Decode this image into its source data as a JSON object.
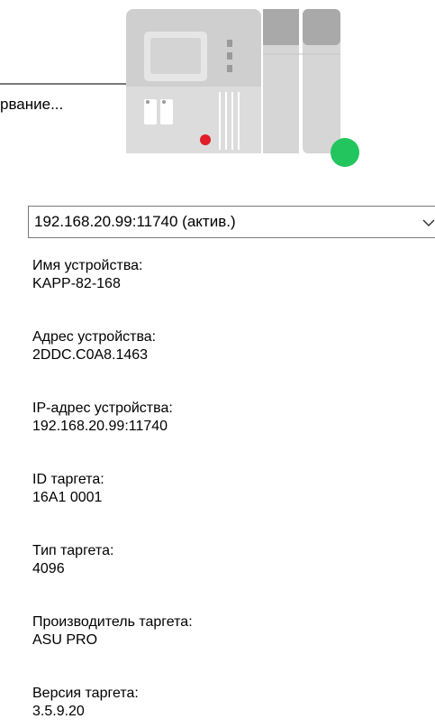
{
  "window": {
    "partial_label": "рвание..."
  },
  "status": {
    "indicator_color": "#22c55e",
    "led_color": "#e11d2a"
  },
  "connection": {
    "selected": "192.168.20.99:11740 (актив.)"
  },
  "device_info": {
    "items": [
      {
        "label": "Имя устройства:",
        "value": "KAPP-82-168"
      },
      {
        "label": "Адрес устройства:",
        "value": "2DDC.C0A8.1463"
      },
      {
        "label": "IP-адрес устройства:",
        "value": "192.168.20.99:11740"
      },
      {
        "label": "ID таргета:",
        "value": "16A1 0001"
      },
      {
        "label": "Тип таргета:",
        "value": "4096"
      },
      {
        "label": "Производитель таргета:",
        "value": "ASU PRO"
      },
      {
        "label": "Версия таргета:",
        "value": "3.5.9.20"
      }
    ]
  }
}
